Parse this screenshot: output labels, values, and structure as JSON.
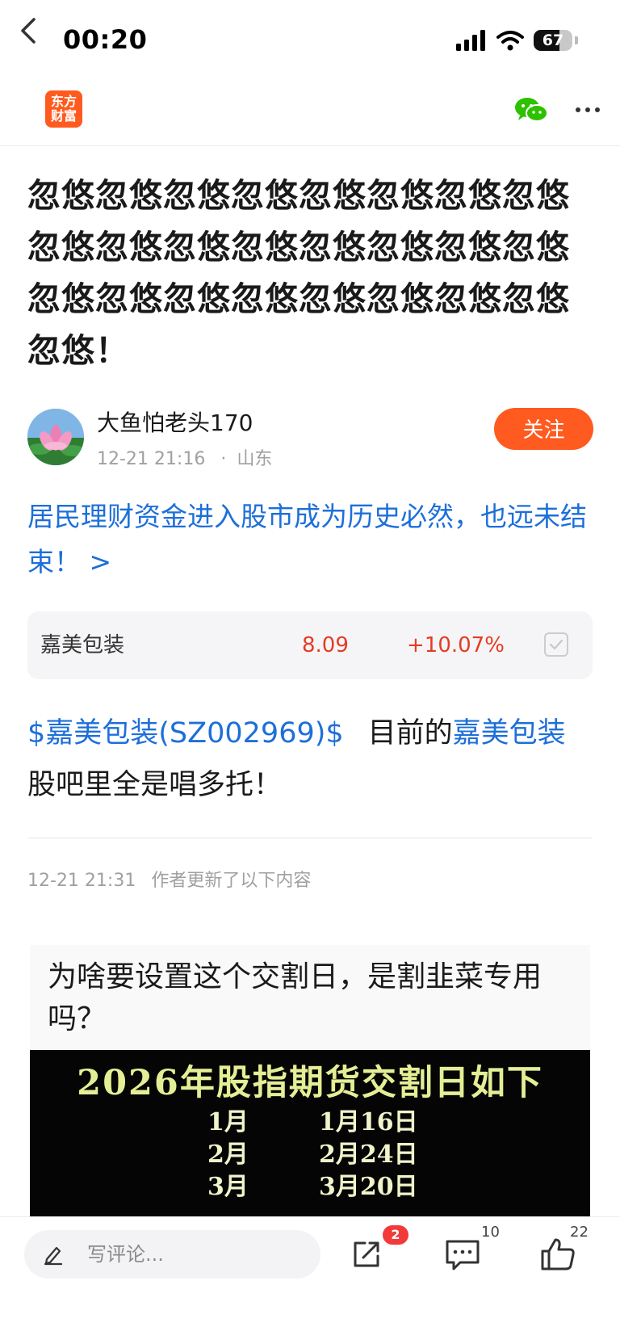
{
  "status_bar": {
    "time": "00:20",
    "battery": "67",
    "battery_level": 0.67
  },
  "nav": {
    "logo_line1": "东方",
    "logo_line2": "财富"
  },
  "post": {
    "title": "忽悠忽悠忽悠忽悠忽悠忽悠忽悠忽悠忽悠忽悠忽悠忽悠忽悠忽悠忽悠忽悠忽悠忽悠忽悠忽悠忽悠忽悠忽悠忽悠忽悠！",
    "author": "大鱼怕老头170",
    "timestamp": "12-21 21:16",
    "location_separator": "·",
    "location": "山东",
    "follow_label": "关注",
    "topic_link": "居民理财资金进入股市成为历史必然，也远未结束！ >",
    "stock": {
      "name": "嘉美包装",
      "price": "8.09",
      "change": "+10.07%"
    },
    "body": {
      "stock_tag": "$嘉美包装(SZ002969)$",
      "text1": "目前的",
      "stock_link": "嘉美包装",
      "text2": "股吧里全是唱多托！"
    },
    "update_time": "12-21 21:31",
    "update_note": "作者更新了以下内容",
    "image": {
      "caption": "为啥要设置这个交割日，是割韭菜专用吗？",
      "heading": "2026年股指期货交割日如下",
      "rows": [
        {
          "month": "1月",
          "date": "1月16日"
        },
        {
          "month": "2月",
          "date": "2月24日"
        },
        {
          "month": "3月",
          "date": "3月20日"
        }
      ]
    }
  },
  "bottom_bar": {
    "comment_placeholder": "写评论...",
    "share_badge": "2",
    "comment_count": "10",
    "like_count": "22"
  },
  "colors": {
    "accent": "#ff5a1f",
    "link": "#1d6fd9",
    "stock_up": "#e53c23",
    "badge": "#f33a3a"
  }
}
